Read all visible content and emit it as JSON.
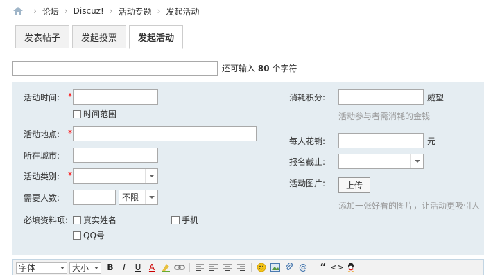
{
  "breadcrumb": {
    "items": [
      "论坛",
      "Discuz!",
      "活动专题",
      "发起活动"
    ]
  },
  "tabs": [
    {
      "label": "发表帖子"
    },
    {
      "label": "发起投票"
    },
    {
      "label": "发起活动"
    }
  ],
  "subject": {
    "value": "",
    "hint_prefix": "还可输入",
    "hint_count": "80",
    "hint_suffix": "个字符"
  },
  "form": {
    "time_label": "活动时间:",
    "time_range_label": "时间范围",
    "location_label": "活动地点:",
    "city_label": "所在城市:",
    "category_label": "活动类别:",
    "people_label": "需要人数:",
    "people_limit_value": "不限",
    "required_label": "必填资料项:",
    "real_name_label": "真实姓名",
    "phone_label": "手机",
    "qq_label": "QQ号",
    "points_label": "消耗积分:",
    "points_unit": "威望",
    "points_hint": "活动参与者需消耗的金钱",
    "cost_label": "每人花销:",
    "cost_unit": "元",
    "deadline_label": "报名截止:",
    "image_label": "活动图片:",
    "upload_label": "上传",
    "image_hint": "添加一张好看的图片，让活动更吸引人",
    "required_mark": "*"
  },
  "editor": {
    "font_label": "字体",
    "size_label": "大小",
    "bold": "B",
    "italic": "I",
    "underline": "U",
    "color": "A",
    "quote": "“",
    "code": "<>"
  },
  "colors": {
    "panel_bg": "#e5edf2",
    "panel_border": "#c2d5e3",
    "required": "#ff0000",
    "hint": "#999999"
  }
}
